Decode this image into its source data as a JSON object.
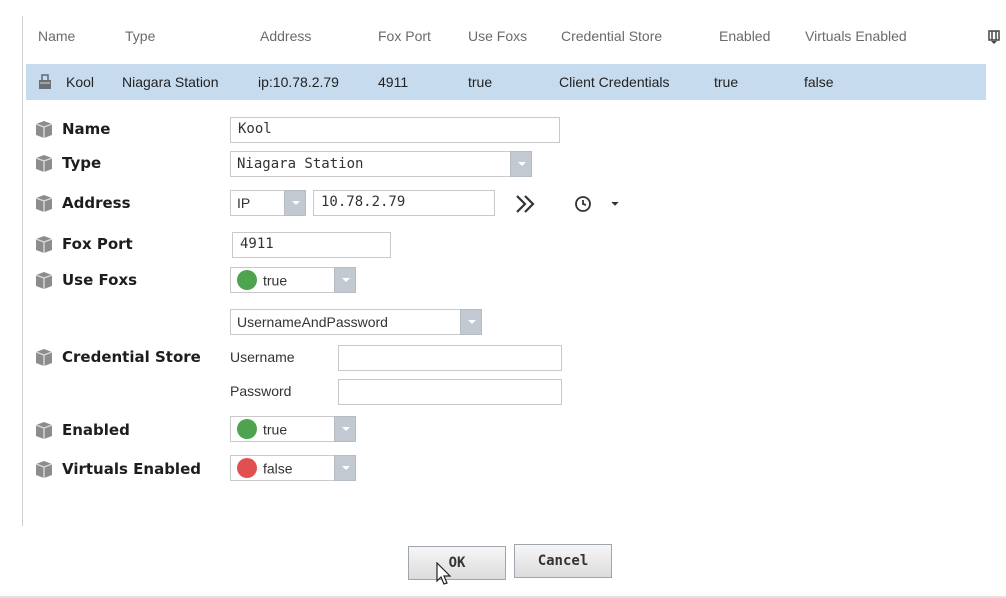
{
  "table": {
    "headers": [
      "Name",
      "Type",
      "Address",
      "Fox Port",
      "Use Foxs",
      "Credential Store",
      "Enabled",
      "Virtuals Enabled"
    ],
    "row": [
      "Kool",
      "Niagara Station",
      "ip:10.78.2.79",
      "4911",
      "true",
      "Client Credentials",
      "true",
      "false"
    ],
    "column_config_icon": "column-chooser-icon"
  },
  "properties": {
    "name": {
      "label": "Name",
      "value": "Kool"
    },
    "type": {
      "label": "Type",
      "value": "Niagara Station"
    },
    "address": {
      "label": "Address",
      "scheme": "IP",
      "value": "10.78.2.79"
    },
    "fox_port": {
      "label": "Fox Port",
      "value": "4911"
    },
    "use_foxs": {
      "label": "Use Foxs",
      "value": "true"
    },
    "credential_store": {
      "label": "Credential Store",
      "mode": "UsernameAndPassword",
      "username_label": "Username",
      "username_value": "",
      "password_label": "Password",
      "password_value": ""
    },
    "enabled": {
      "label": "Enabled",
      "value": "true"
    },
    "virtuals_enabled": {
      "label": "Virtuals Enabled",
      "value": "false"
    }
  },
  "buttons": {
    "ok": "OK",
    "cancel": "Cancel"
  },
  "colors": {
    "selected_row": "#c7dbef",
    "true_dot": "#4ea34f",
    "false_dot": "#e15050"
  }
}
